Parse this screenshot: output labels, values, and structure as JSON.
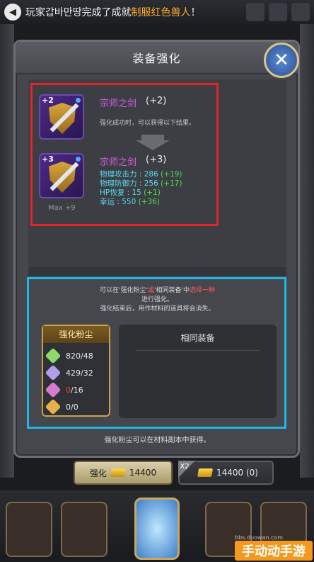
{
  "announcement": {
    "user": "玩家갑바만땅",
    "middle": "完成了成就",
    "achievement": "制服红色兽人",
    "end": "！"
  },
  "panel": {
    "title": "装备强化",
    "close_label": "✕"
  },
  "current_item": {
    "level_badge": "+2",
    "name": "宗师之剑",
    "level": "(+2)",
    "description": "强化成功时，可以获得以下结果。"
  },
  "next_item": {
    "level_badge": "+3",
    "name": "宗师之剑",
    "level": "(+3)",
    "max_label": "Max +9",
    "stats": [
      {
        "label": "物理攻击力 : 286",
        "bonus": "(+19)"
      },
      {
        "label": "物理防御力 : 256",
        "bonus": "(+17)"
      },
      {
        "label": "HP恢复 : 15",
        "bonus": "(+1)"
      },
      {
        "label": "幸运 : 550",
        "bonus": "(+36)"
      }
    ]
  },
  "instructions": {
    "line1_a": "可以在'强化粉尘'",
    "line1_or": "或",
    "line1_b": "'相同装备'中",
    "line1_choose": "选择一种",
    "line2": "进行强化。",
    "line3": "强化结束后，用作材料的道具将会消失。"
  },
  "dust": {
    "header": "强化粉尘",
    "rows": [
      {
        "value": "820/48",
        "red": "",
        "color": "#8fd86a"
      },
      {
        "value": "429/32",
        "red": "",
        "color": "#b0a0e8"
      },
      {
        "value": "/16",
        "red": "0",
        "color": "#d87ad0"
      },
      {
        "value": "0/0",
        "red": "",
        "color": "#e8b04a"
      }
    ]
  },
  "same_equipment": {
    "header": "相同装备"
  },
  "footer_note": "强化粉尘可以在材料副本中获得。",
  "buttons": {
    "enhance_label": "强化",
    "enhance_cost": "14400",
    "x2_tag": "X2",
    "x2_cost": "14400 (0)"
  },
  "watermark": {
    "text": "手动动手游",
    "url": "bbs.duowan.com"
  },
  "colors": {
    "red_frame": "#e3242b",
    "cyan_frame": "#1fb9e8",
    "item_name": "#d65fe8",
    "stat": "#5ad8f0",
    "bonus": "#4ee04e"
  }
}
